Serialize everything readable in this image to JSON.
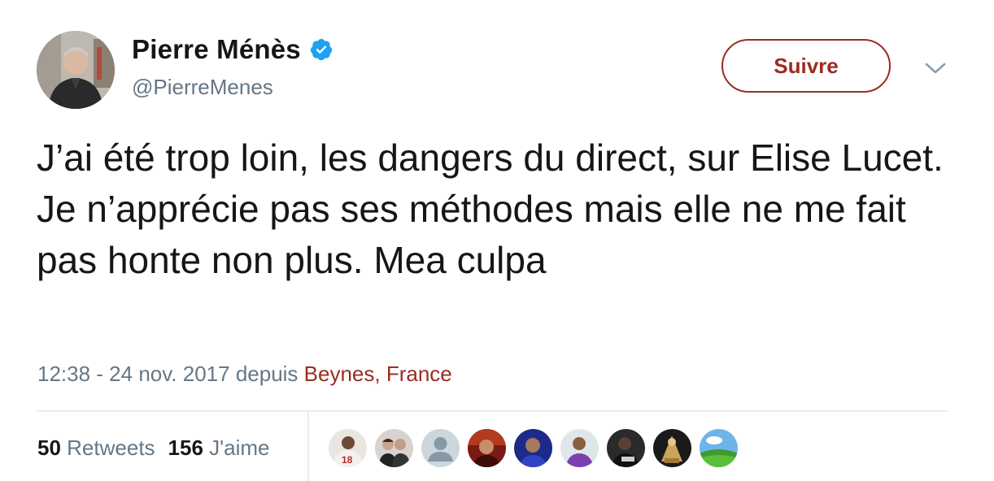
{
  "user": {
    "display_name": "Pierre Ménès",
    "handle": "@PierreMenes",
    "verified_icon": "verified-badge-icon",
    "verified_color": "#1da1f2"
  },
  "follow_button": {
    "label": "Suivre",
    "color": "#9b2c22"
  },
  "more_menu_icon": "chevron-down-icon",
  "tweet": {
    "text": "J’ai été trop loin, les dangers du direct, sur Elise Lucet. Je n’apprécie pas ses méthodes mais elle ne me fait pas honte non plus. Mea culpa",
    "timestamp": "12:38 - 24 nov. 2017 depuis ",
    "location": "Beynes, France"
  },
  "stats": {
    "retweets_count": "50",
    "retweets_label": "Retweets",
    "likes_count": "156",
    "likes_label": "J'aime"
  },
  "colors": {
    "text": "#14171a",
    "secondary": "#657786",
    "accent": "#9b2c22",
    "divider": "#e6ecf0"
  }
}
